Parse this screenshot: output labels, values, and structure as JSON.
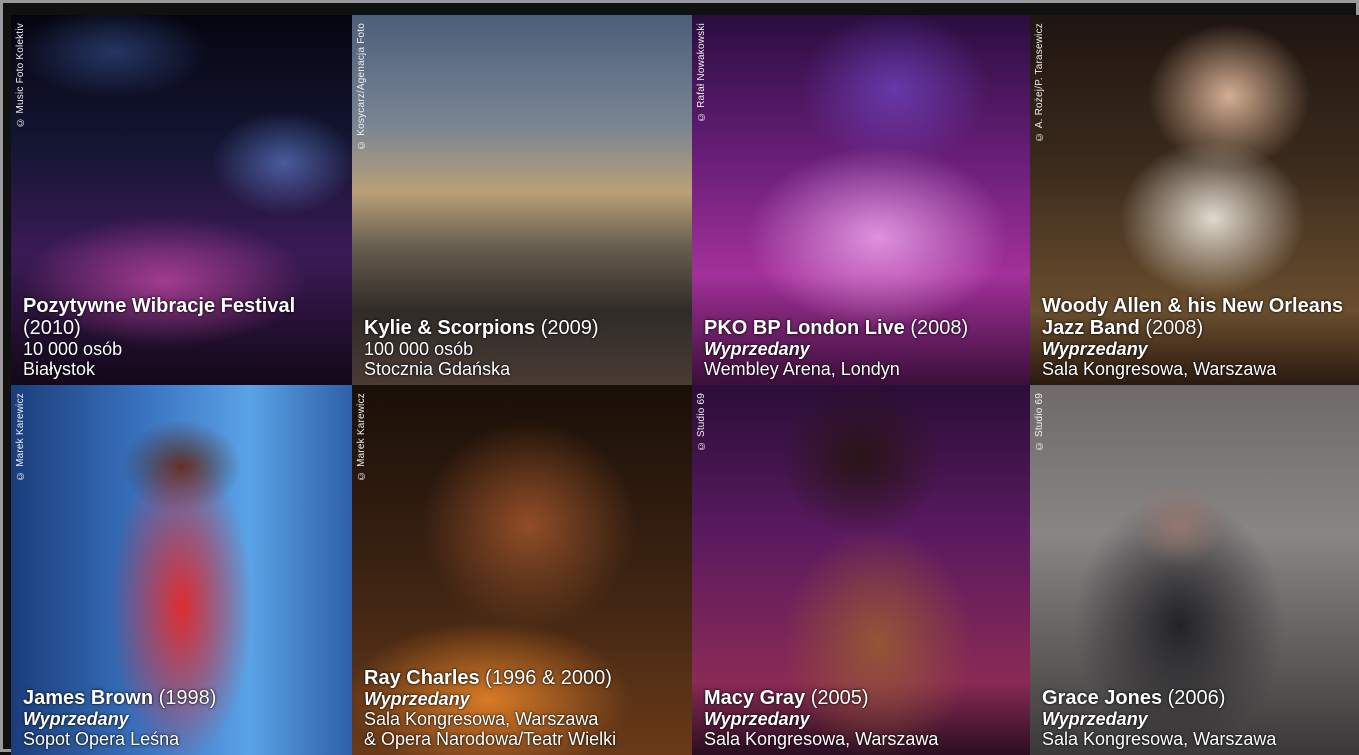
{
  "tiles": [
    {
      "credit": "© Music Foto Kolektiv",
      "title": "Pozytywne Wibracje Festival",
      "year": " (2010)",
      "status": "",
      "lines": [
        "10 000 osób",
        "Białystok"
      ]
    },
    {
      "credit": "© Kosycarz/Agenacja Foto",
      "title": "Kylie & Scorpions",
      "year": " (2009)",
      "status": "",
      "lines": [
        "100 000 osób",
        "Stocznia Gdańska"
      ]
    },
    {
      "credit": "© Rafał Nowakowski",
      "title": "PKO BP London Live",
      "year": " (2008)",
      "status": "Wyprzedany",
      "lines": [
        "Wembley Arena, Londyn"
      ]
    },
    {
      "credit": "© A. Rożej/P. Tarasewicz",
      "title": "Woody Allen & his New Orleans Jazz Band",
      "year": " (2008)",
      "status": "Wyprzedany",
      "lines": [
        "Sala Kongresowa, Warszawa"
      ]
    },
    {
      "credit": "© Marek Karewicz",
      "title": "James Brown",
      "year": " (1998)",
      "status": "Wyprzedany",
      "lines": [
        "Sopot Opera Leśna"
      ]
    },
    {
      "credit": "© Marek Karewicz",
      "title": "Ray Charles",
      "year": " (1996 & 2000)",
      "status": "Wyprzedany",
      "lines": [
        "Sala Kongresowa, Warszawa",
        "& Opera Narodowa/Teatr Wielki"
      ]
    },
    {
      "credit": "© Studio 69",
      "title": "Macy Gray",
      "year": " (2005)",
      "status": "Wyprzedany",
      "lines": [
        "Sala Kongresowa, Warszawa"
      ]
    },
    {
      "credit": "© Studio 69",
      "title": "Grace Jones",
      "year": " (2006)",
      "status": "Wyprzedany",
      "lines": [
        "Sala Kongresowa, Warszawa"
      ]
    }
  ]
}
